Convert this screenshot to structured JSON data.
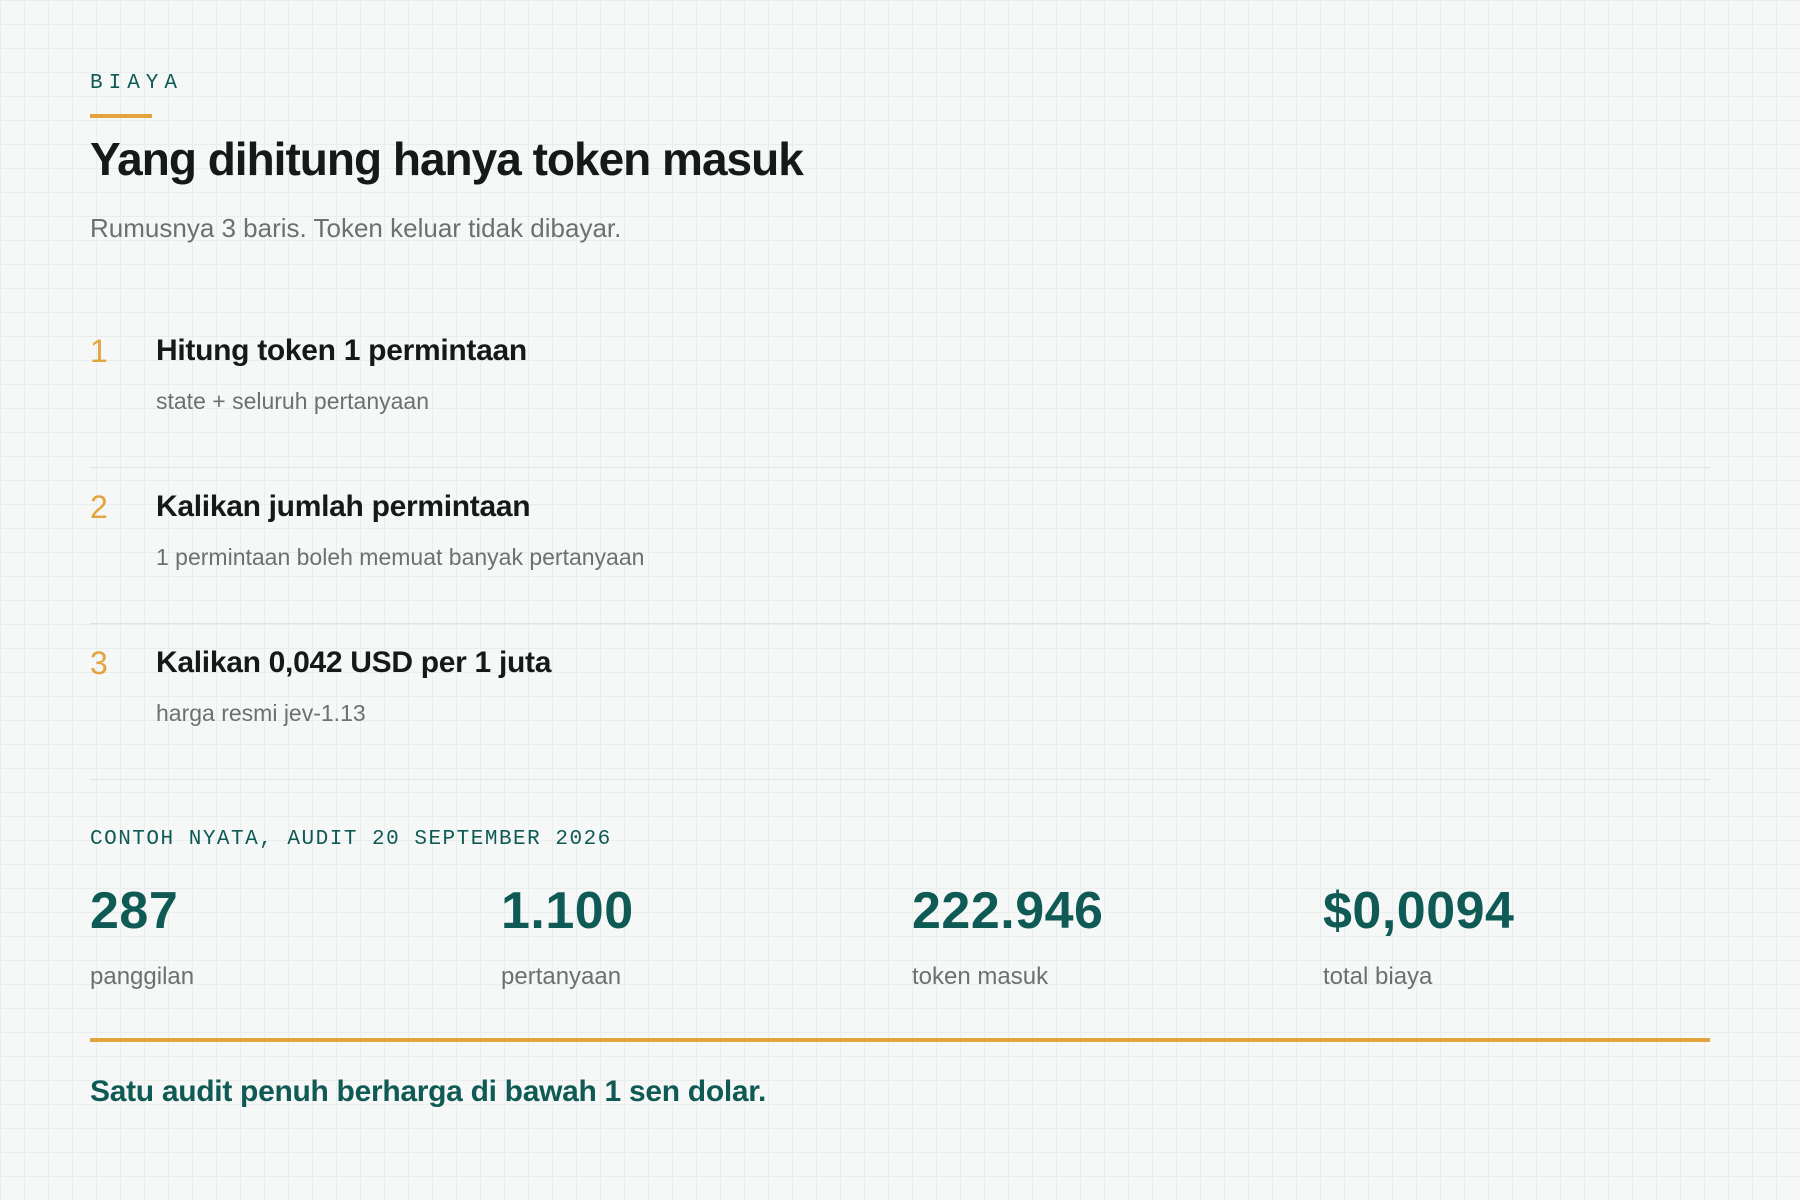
{
  "header": {
    "eyebrow": "BIAYA",
    "title": "Yang dihitung hanya token masuk",
    "subtitle": "Rumusnya 3 baris. Token keluar tidak dibayar."
  },
  "steps": [
    {
      "number": "1",
      "title": "Hitung token 1 permintaan",
      "description": "state + seluruh pertanyaan"
    },
    {
      "number": "2",
      "title": "Kalikan jumlah permintaan",
      "description": "1 permintaan boleh memuat banyak pertanyaan"
    },
    {
      "number": "3",
      "title": "Kalikan 0,042 USD per 1 juta",
      "description": "harga resmi jev-1.13"
    }
  ],
  "example": {
    "label": "CONTOH NYATA, AUDIT 20 SEPTEMBER 2026",
    "stats": [
      {
        "value": "287",
        "label": "panggilan"
      },
      {
        "value": "1.100",
        "label": "pertanyaan"
      },
      {
        "value": "222.946",
        "label": "token masuk"
      },
      {
        "value": "$0,0094",
        "label": "total biaya"
      }
    ]
  },
  "conclusion": "Satu audit penuh berharga di bawah 1 sen dolar.",
  "colors": {
    "accent": "#e3a33d",
    "brand": "#0f5a55",
    "text": "#16191a",
    "muted": "#6a716e"
  }
}
